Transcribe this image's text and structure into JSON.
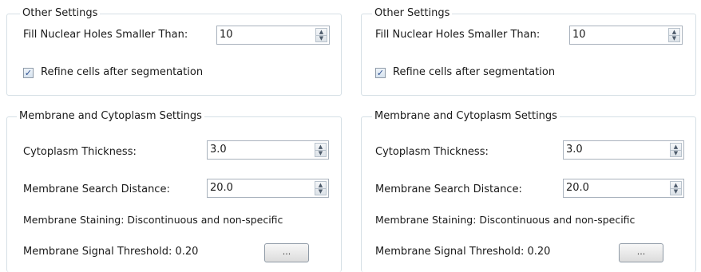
{
  "panels": [
    {
      "other_settings": {
        "title": "Other Settings",
        "fill_holes_label": "Fill Nuclear Holes Smaller Than:",
        "fill_holes_value": "10",
        "refine_label": "Refine cells after segmentation",
        "refine_checked": true,
        "check_glyph": "✓"
      },
      "membrane": {
        "title": "Membrane and Cytoplasm Settings",
        "cyto_label": "Cytoplasm Thickness:",
        "cyto_value": "3.0",
        "search_label": "Membrane Search Distance:",
        "search_value": "20.0",
        "staining_text": "Membrane Staining: Discontinuous and non-specific",
        "threshold_text": "Membrane Signal Threshold: 0.20",
        "browse_label": "..."
      }
    },
    {
      "other_settings": {
        "title": "Other Settings",
        "fill_holes_label": "Fill Nuclear Holes Smaller Than:",
        "fill_holes_value": "10",
        "refine_label": "Refine cells after segmentation",
        "refine_checked": true,
        "check_glyph": "✓"
      },
      "membrane": {
        "title": "Membrane and Cytoplasm Settings",
        "cyto_label": "Cytoplasm Thickness:",
        "cyto_value": "3.0",
        "search_label": "Membrane Search Distance:",
        "search_value": "20.0",
        "staining_text": "Membrane Staining: Discontinuous and non-specific",
        "threshold_text": "Membrane Signal Threshold: 0.20",
        "browse_label": "..."
      }
    }
  ],
  "icons": {
    "spin_up": "▲",
    "spin_down": "▼"
  }
}
